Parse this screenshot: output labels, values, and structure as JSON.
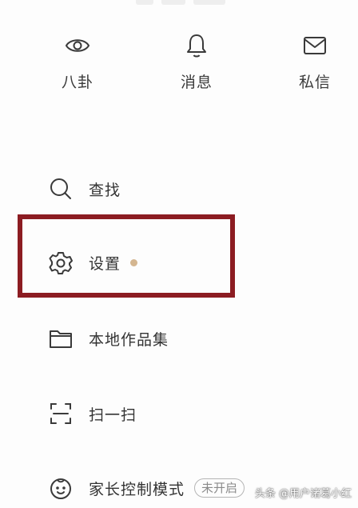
{
  "top_row": {
    "gossip_label": "八卦",
    "messages_label": "消息",
    "direct_messages_label": "私信"
  },
  "menu": {
    "search_label": "查找",
    "settings_label": "设置",
    "local_works_label": "本地作品集",
    "scan_label": "扫一扫",
    "parental_label": "家长控制模式",
    "parental_status": "未开启"
  },
  "icons": {
    "gossip": "eye-icon",
    "messages": "bell-icon",
    "direct_messages": "envelope-icon",
    "search": "search-icon",
    "settings": "gear-icon",
    "local_works": "folder-icon",
    "scan": "scan-icon",
    "parental": "child-face-icon"
  },
  "colors": {
    "highlight_box": "#8c1c22",
    "settings_dot": "#d4b690",
    "text": "#333333"
  },
  "watermark": "头条 @用户诸葛小红"
}
